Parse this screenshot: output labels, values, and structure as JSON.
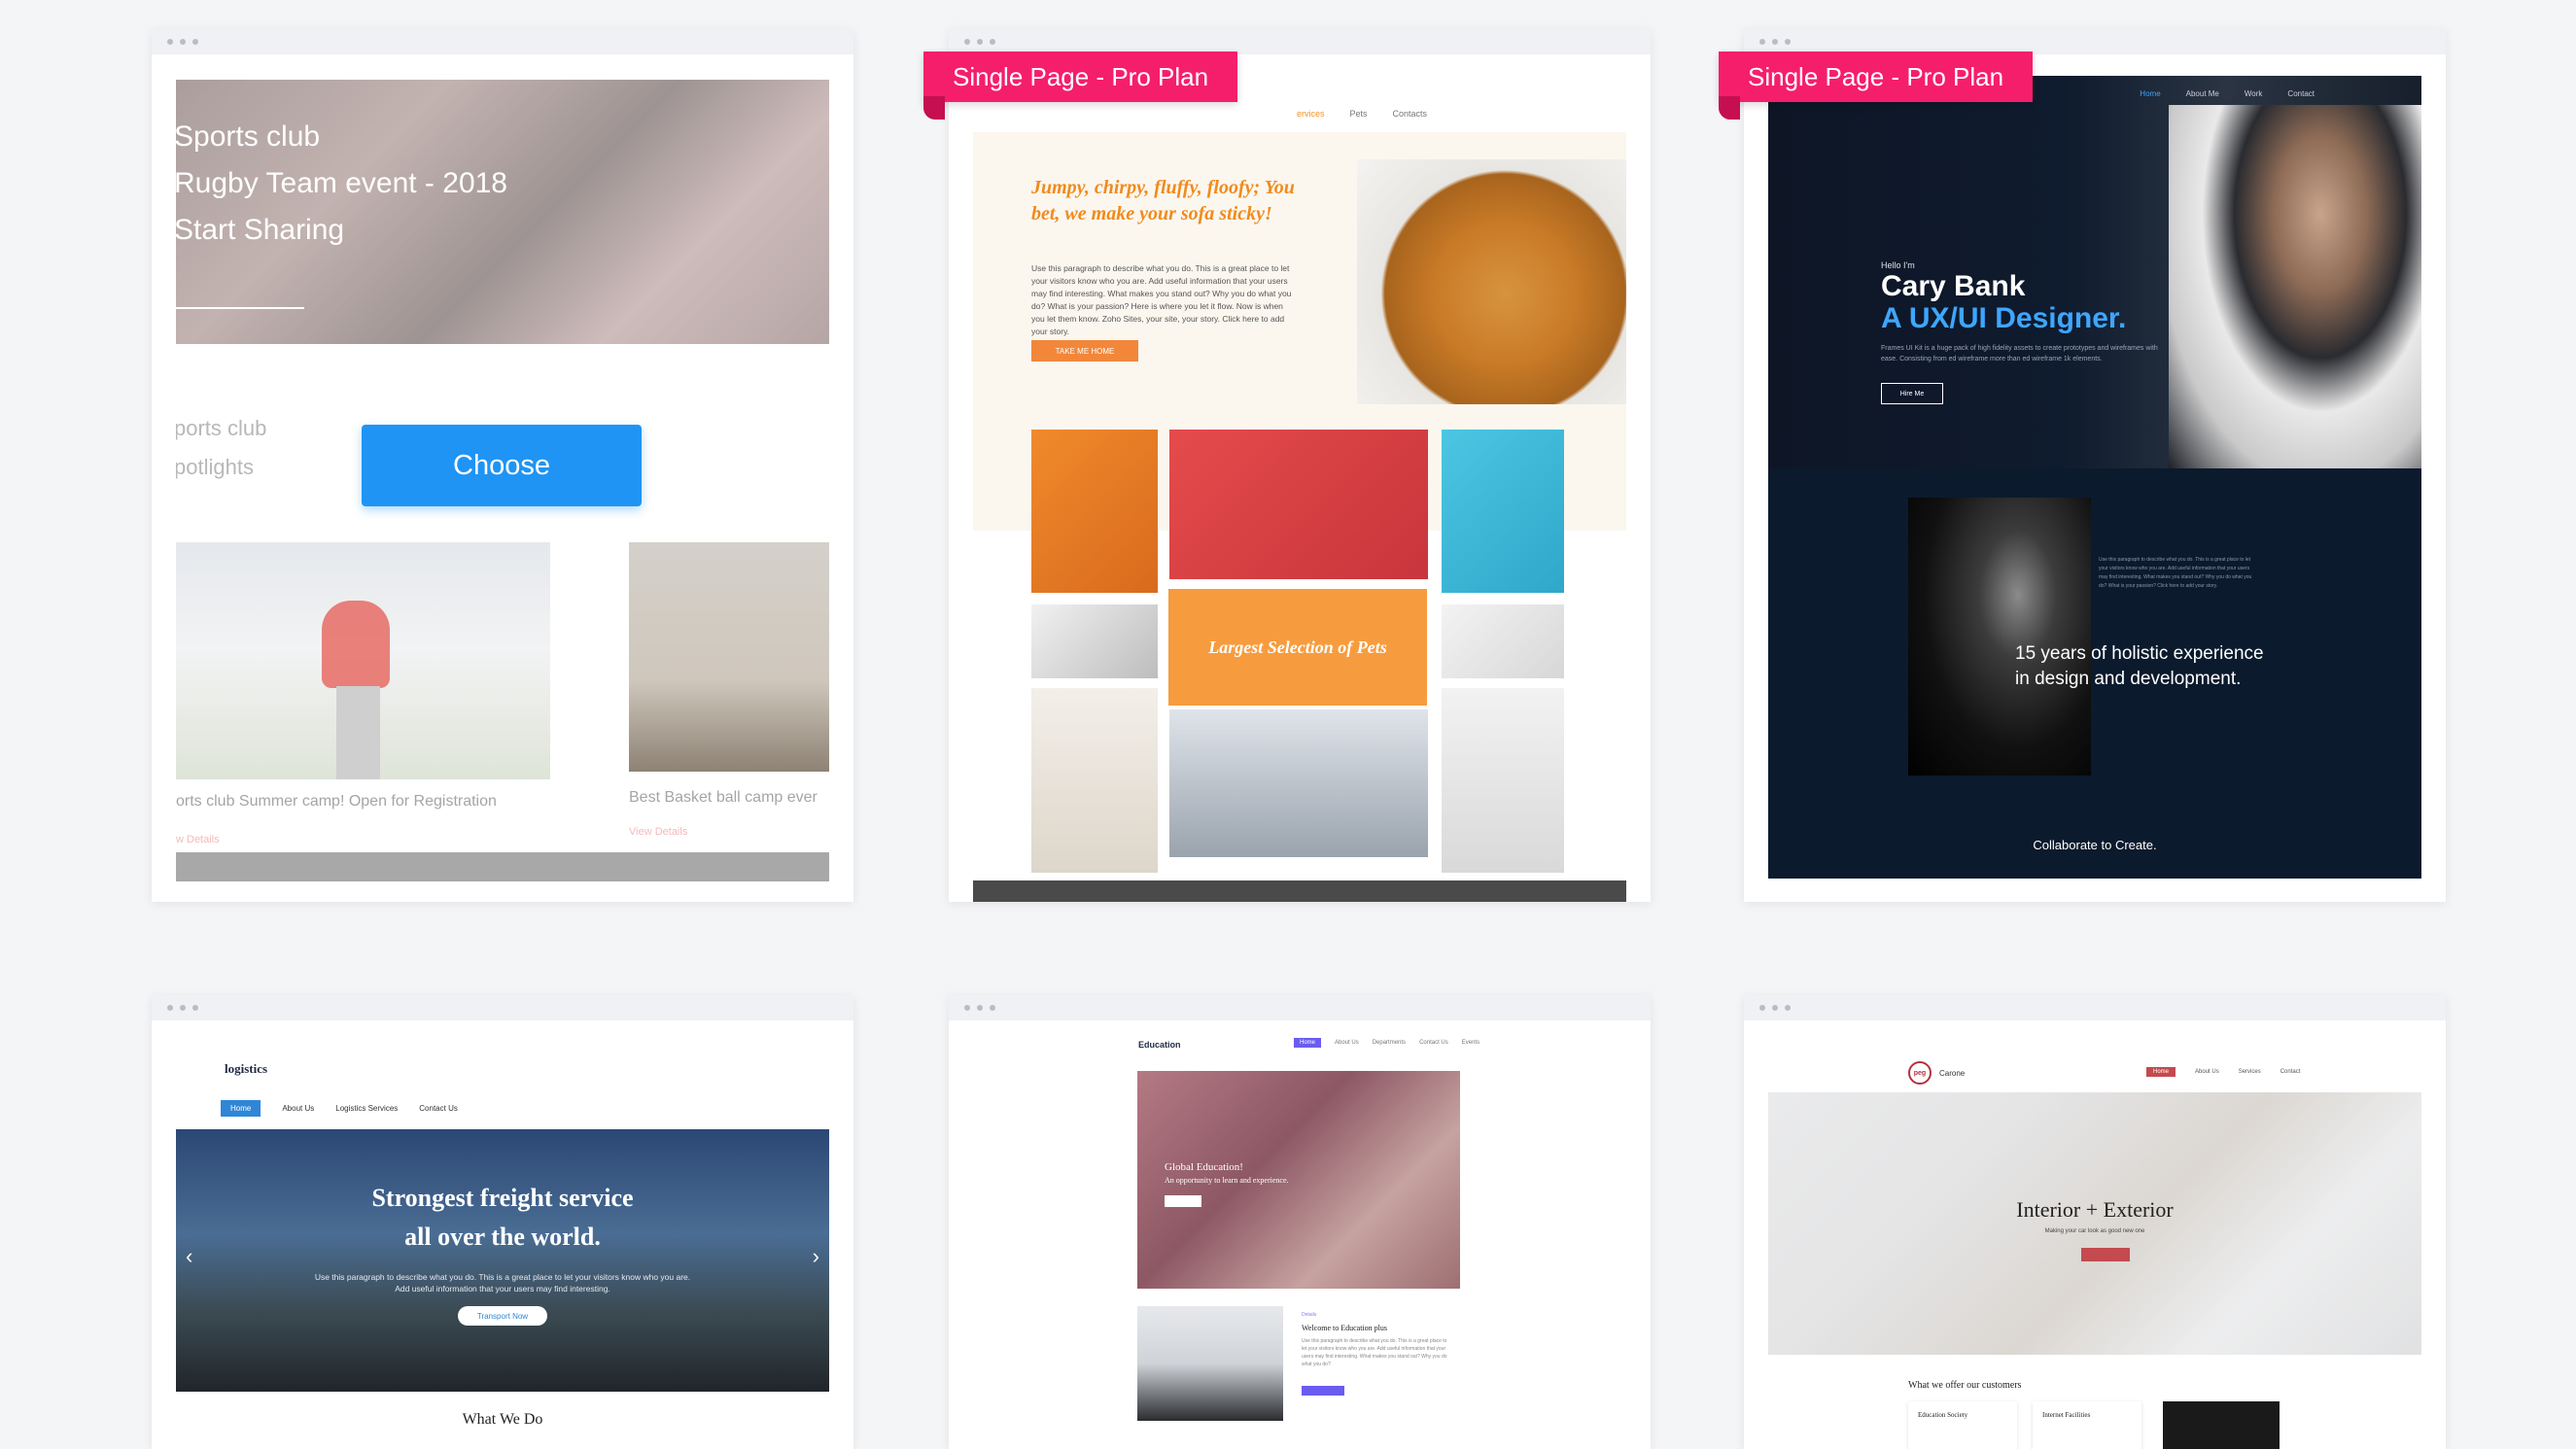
{
  "gallery": {
    "choose_label": "Choose",
    "badge": "Single Page - Pro Plan"
  },
  "sports": {
    "hero_lines": [
      "Sports club",
      "Rugby Team event - 2018",
      "Start Sharing"
    ],
    "section_lines": [
      "ports club",
      "potlights"
    ],
    "captions": [
      "orts club Summer camp! Open for Registration",
      "Best Basket ball camp ever"
    ],
    "links": [
      "w Details",
      "View Details"
    ]
  },
  "pets": {
    "nav": [
      "ervices",
      "Pets",
      "Contacts"
    ],
    "heading": "Jumpy, chirpy, fluffy, floofy; You bet, we make your sofa sticky!",
    "paragraph": "Use this paragraph to describe what you do. This is a great place to let your visitors know who you are. Add useful information that your users may find interesting. What makes you stand out? Why you do what you do? What is your passion? Here is where you let it flow. Now is when you let them know. Zoho Sites, your site, your story. Click here to add your story.",
    "button": "TAKE ME HOME",
    "selection": "Largest Selection of Pets"
  },
  "designer": {
    "nav": [
      "Home",
      "About Me",
      "Work",
      "Contact"
    ],
    "hello": "Hello I'm",
    "name": "Cary Bank",
    "role": "A UX/UI Designer.",
    "paragraph": "Frames UI Kit is a huge pack of high fidelity assets to create prototypes and wireframes with ease. Consisting from ed wireframe more than ed wireframe 1k elements.",
    "button": "Hire Me",
    "small_paragraph": "Use this paragraph to describe what you do. This is a great place to let your visitors know who you are. Add useful information that your users may find interesting. What makes you stand out? Why you do what you do? What is your passion? Click here to add your story.",
    "years": "15 years of holistic experience in design and development.",
    "collab": "Collaborate to Create."
  },
  "logistics": {
    "logo": "logistics",
    "nav": [
      "Home",
      "About Us",
      "Logistics Services",
      "Contact Us"
    ],
    "headline_1": "Strongest freight service",
    "headline_2": "all over the world.",
    "paragraph": "Use this paragraph to describe what you do. This is a great place to let your visitors know who you are. Add useful information that your users may find interesting.",
    "button": "Transport Now",
    "what": "What We Do",
    "prev_arrow": "‹",
    "next_arrow": "›"
  },
  "education": {
    "logo": "Education",
    "nav": [
      "Home",
      "About Us",
      "Departments",
      "Contact Us",
      "Events"
    ],
    "hero_1": "Global Education!",
    "hero_2": "An opportunity to learn and experience.",
    "sub": "Details",
    "welcome": "Welcome to Education plus",
    "paragraph": "Use this paragraph to describe what you do. This is a great place to let your visitors know who you are. Add useful information that your users may find interesting. What makes you stand out? Why you do what you do?"
  },
  "garage": {
    "logo_ring": "peg",
    "logo": "Carone",
    "nav": [
      "Home",
      "About Us",
      "Services",
      "Contact"
    ],
    "headline": "Interior + Exterior",
    "sub": "Making your car look as good new one",
    "offer": "What we offer our customers",
    "box1": "Education Society",
    "box2": "Internet Facilities"
  },
  "colors": {
    "badge": "#f51e6b",
    "choose": "#1f94f4",
    "pets_orange": "#f28a1b",
    "designer_blue": "#3ea6ff"
  }
}
